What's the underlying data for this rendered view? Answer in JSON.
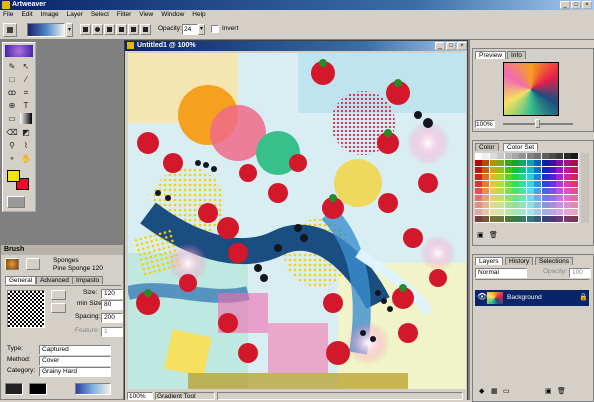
{
  "app": {
    "title": "Artweaver"
  },
  "menu": [
    "File",
    "Edit",
    "Image",
    "Layer",
    "Select",
    "Filter",
    "View",
    "Window",
    "Help"
  ],
  "options": {
    "opacity_label": "Opacity:",
    "opacity_value": "24",
    "invert_label": "Invert"
  },
  "document": {
    "title": "Untitled1 @ 100%",
    "zoom": "100%",
    "status_tool": "Gradient Tool"
  },
  "brush": {
    "title": "Brush",
    "category_name": "Sponges",
    "variant_name": "Pine Sponge 120",
    "tabs": [
      "General",
      "Advanced",
      "Impasto"
    ],
    "size_label": "Size:",
    "size_value": "120",
    "minsize_label": "min Size:",
    "minsize_value": "80",
    "spacing_label": "Spacing:",
    "spacing_value": "200",
    "feature_label": "Feature:",
    "feature_value": "1",
    "type_label": "Type:",
    "type_value": "Captured",
    "method_label": "Method:",
    "method_value": "Cover",
    "category_label": "Category:",
    "category_value": "Grainy Hard"
  },
  "preview": {
    "tabs": [
      "Preview",
      "Info"
    ],
    "zoom": "100%"
  },
  "color": {
    "tabs": [
      "Color",
      "Color Set"
    ]
  },
  "layers": {
    "tabs": [
      "Layers",
      "History",
      "Selections"
    ],
    "blend_mode": "Normal",
    "opacity_label": "Opacity:",
    "opacity_value": "100",
    "layer_name": "Background"
  },
  "colors": {
    "accent": "#0a246a",
    "foreground": "#f2e600",
    "background_color": "#e0102f",
    "panel": "#d4d0c8"
  }
}
